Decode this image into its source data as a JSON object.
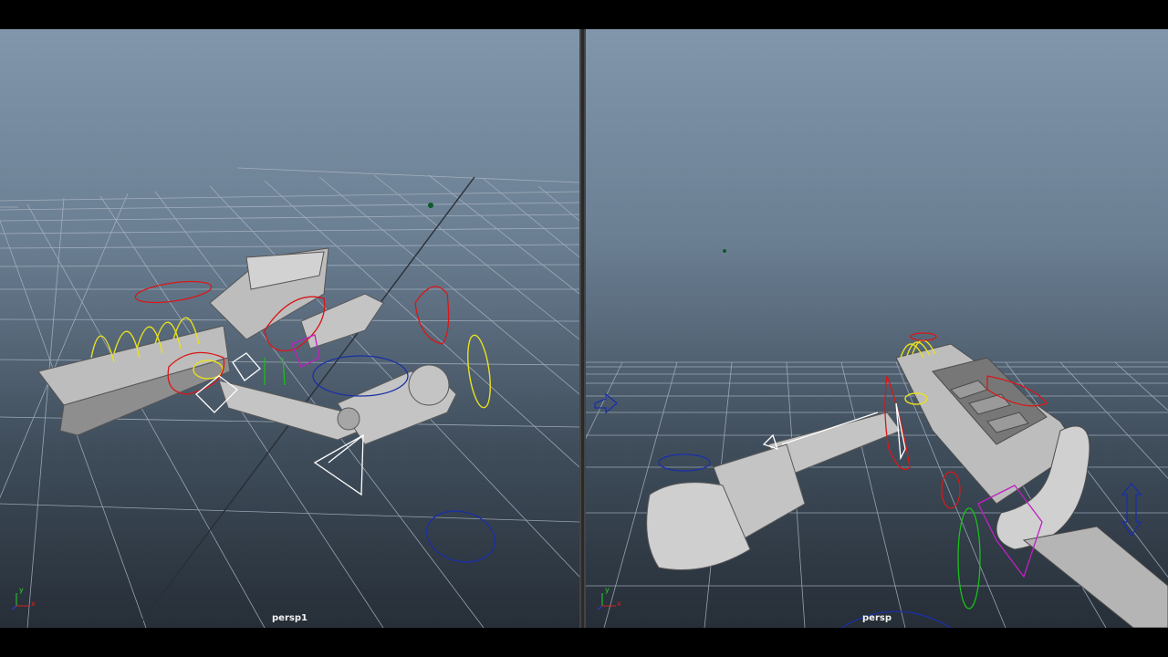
{
  "viewports": {
    "left": {
      "camera_label": "persp1"
    },
    "right": {
      "camera_label": "persp"
    }
  },
  "axis_gizmo": {
    "y_label": "y",
    "x_label": "x"
  },
  "colors": {
    "grid": "#aab5c2",
    "yellow_control": "#e8e020",
    "red_control": "#d81818",
    "blue_control": "#1a2fa8",
    "magenta_control": "#c020c0",
    "green_control": "#18c018",
    "mesh": "#bdbdbd"
  }
}
